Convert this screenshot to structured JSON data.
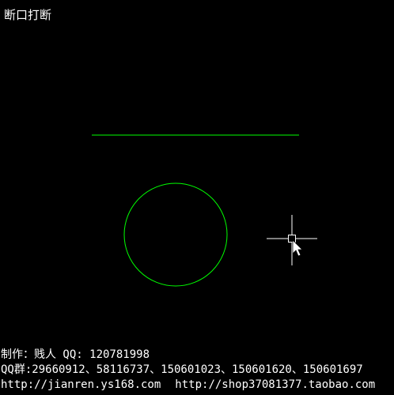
{
  "title": "断口打断",
  "colors": {
    "background": "#000000",
    "geometry": "#00ff00",
    "crosshair": "#ffffff",
    "text": "#ffffff"
  },
  "cursor": {
    "icon": "crosshair-pickbox-arrow-icon"
  },
  "credits": {
    "author": "制作：贱人 QQ: 120781998",
    "qq_groups": "QQ群:29660912、58116737、150601023、150601620、150601697",
    "site": "http://jianren.ys168.com",
    "shop": "http://shop37081377.taobao.com"
  }
}
